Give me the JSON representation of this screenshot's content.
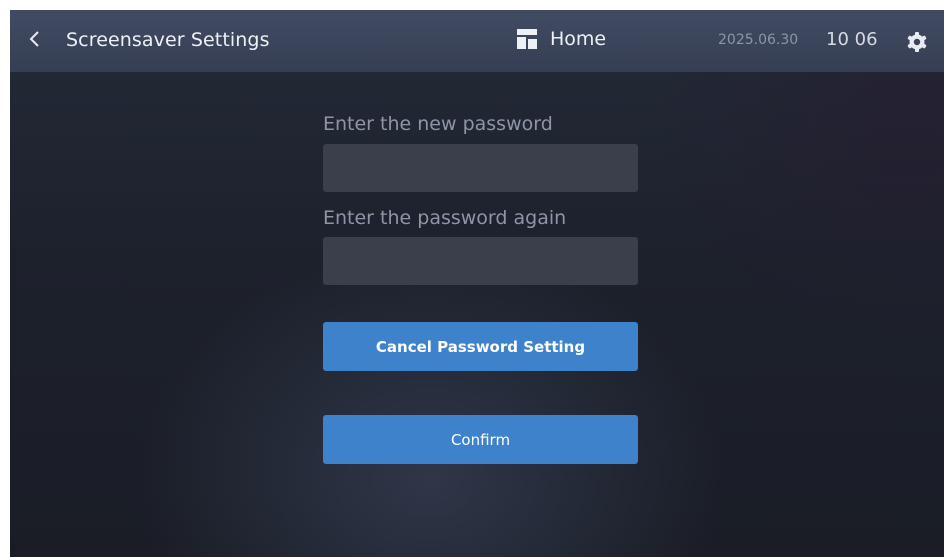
{
  "header": {
    "title": "Screensaver Settings",
    "home_label": "Home",
    "date": "2025.06.30",
    "time": "10 06",
    "back_icon": "chevron-left-icon",
    "home_icon": "home-panel-icon",
    "settings_icon": "gear-icon"
  },
  "form": {
    "new_password_label": "Enter the new password",
    "new_password_value": "",
    "confirm_password_label": "Enter the password again",
    "confirm_password_value": "",
    "cancel_button_label": "Cancel Password Setting",
    "confirm_button_label": "Confirm"
  },
  "colors": {
    "topbar": "#3a4359",
    "background": "#1d212c",
    "input_fill": "#3a3f4b",
    "button_accent": "#3f82cc",
    "label_text": "#8e95a6"
  }
}
